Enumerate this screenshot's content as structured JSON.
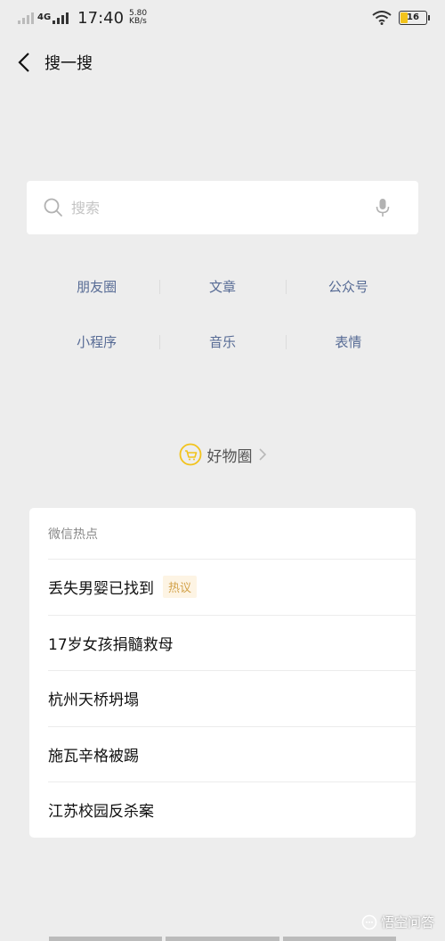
{
  "status_bar": {
    "network": "4G",
    "time": "17:40",
    "speed_value": "5.80",
    "speed_unit": "KB/s",
    "battery": "16"
  },
  "header": {
    "title": "搜一搜",
    "back_icon": "chevron-left-icon"
  },
  "search": {
    "placeholder": "搜索",
    "value": ""
  },
  "categories": [
    [
      "朋友圈",
      "文章",
      "公众号"
    ],
    [
      "小程序",
      "音乐",
      "表情"
    ]
  ],
  "good_things": {
    "label": "好物圈"
  },
  "hot_section": {
    "title": "微信热点",
    "items": [
      {
        "text": "丢失男婴已找到",
        "tag": "热议"
      },
      {
        "text": "17岁女孩捐髓救母",
        "tag": ""
      },
      {
        "text": "杭州天桥坍塌",
        "tag": ""
      },
      {
        "text": "施瓦辛格被踢",
        "tag": ""
      },
      {
        "text": "江苏校园反杀案",
        "tag": ""
      }
    ]
  },
  "watermark": {
    "text": "悟空问答"
  },
  "colors": {
    "background": "#ededed",
    "link_blue": "#576b95",
    "tag_orange": "#d2a24a",
    "icon_yellow": "#f2c31c"
  }
}
